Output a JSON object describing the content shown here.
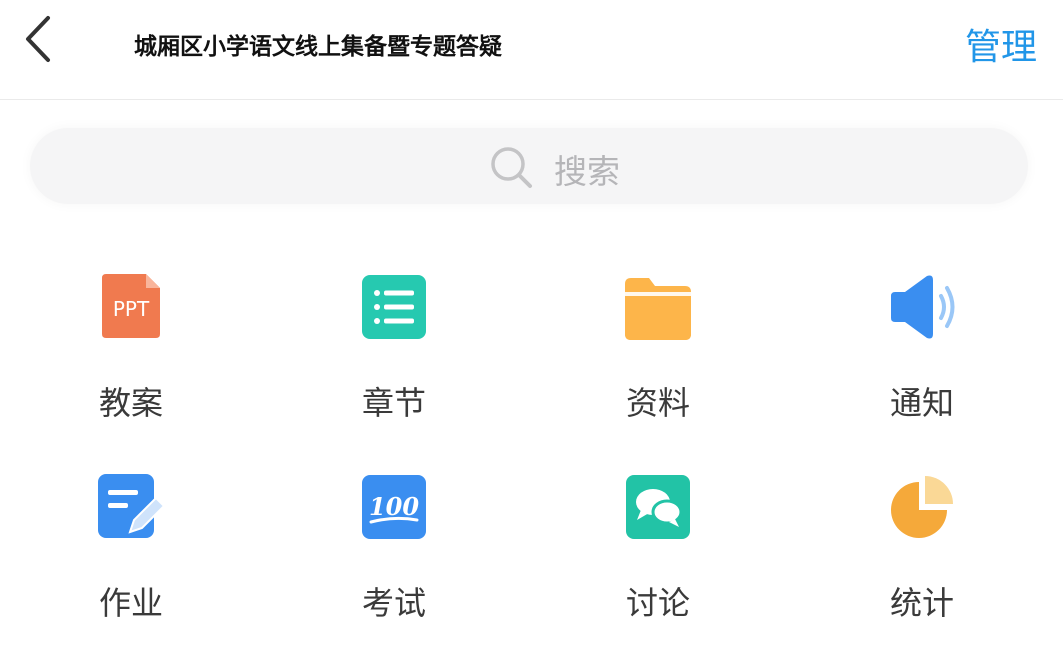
{
  "header": {
    "title": "城厢区小学语文线上集备暨专题答疑",
    "manage_label": "管理",
    "back_icon": "chevron-left-icon"
  },
  "search": {
    "placeholder": "搜索",
    "icon": "search-icon"
  },
  "colors": {
    "accent": "#2196e8",
    "ppt": "#f07a4f",
    "chapter": "#26c9b0",
    "folder": "#fdb54a",
    "speaker": "#3a8ef0",
    "homework": "#3a8ef0",
    "exam": "#3a8ef0",
    "discuss": "#22c3a6",
    "stats": "#f5a93a"
  },
  "grid": {
    "items": [
      {
        "label": "教案",
        "icon": "ppt-icon",
        "icon_text": "PPT"
      },
      {
        "label": "章节",
        "icon": "list-icon"
      },
      {
        "label": "资料",
        "icon": "folder-icon"
      },
      {
        "label": "通知",
        "icon": "speaker-icon"
      },
      {
        "label": "作业",
        "icon": "edit-document-icon"
      },
      {
        "label": "考试",
        "icon": "score-100-icon",
        "icon_text": "100"
      },
      {
        "label": "讨论",
        "icon": "chat-bubbles-icon"
      },
      {
        "label": "统计",
        "icon": "pie-chart-icon"
      }
    ]
  }
}
